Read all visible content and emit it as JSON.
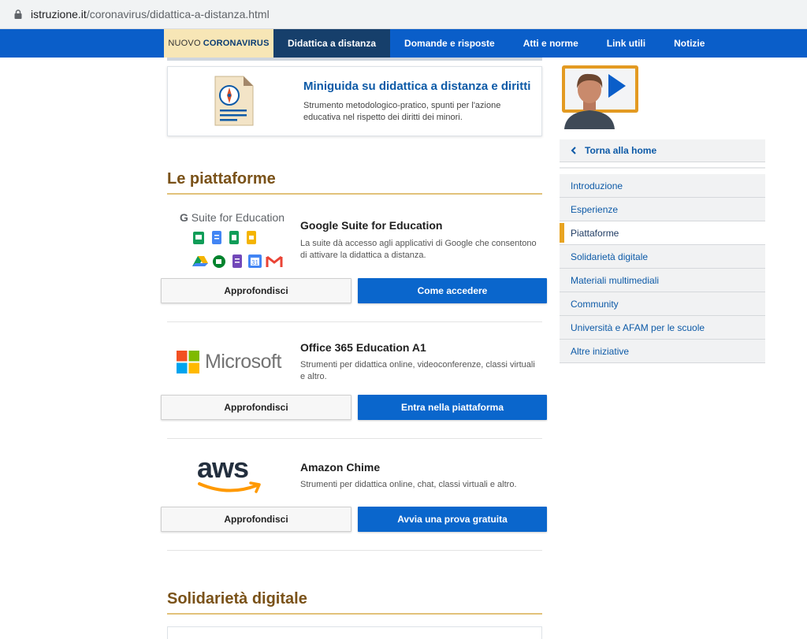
{
  "browser": {
    "url_domain": "istruzione.it",
    "url_path": "/coronavirus/didattica-a-distanza.html"
  },
  "nav": {
    "badge_prefix": "NUOVO",
    "badge_strong": "CORONAVIRUS",
    "items": [
      {
        "label": "Didattica a distanza",
        "active": true
      },
      {
        "label": "Domande e risposte"
      },
      {
        "label": "Atti e norme"
      },
      {
        "label": "Link utili"
      },
      {
        "label": "Notizie"
      }
    ]
  },
  "miniguide": {
    "title": "Miniguida su didattica a distanza e diritti",
    "description": "Strumento metodologico-pratico, spunti per l'azione educativa nel rispetto dei diritti dei minori."
  },
  "sections": {
    "platforms_title": "Le piattaforme",
    "solidarity_title": "Solidarietà digitale"
  },
  "platforms": [
    {
      "logo_text": "G Suite for Education",
      "logo_g": "G",
      "logo_rest": " Suite for Education",
      "title": "Google Suite for Education",
      "description": "La suite dà accesso agli applicativi di Google che consentono di attivare la didattica a distanza.",
      "btn_more": "Approfondisci",
      "btn_action": "Come accedere"
    },
    {
      "logo_text": "Microsoft",
      "title": "Office 365 Education A1",
      "description": "Strumenti per didattica online, videoconferenze, classi virtuali e altro.",
      "btn_more": "Approfondisci",
      "btn_action": "Entra nella piattaforma"
    },
    {
      "logo_text": "aws",
      "title": "Amazon Chime",
      "description": "Strumenti per didattica online, chat, classi virtuali e altro.",
      "btn_more": "Approfondisci",
      "btn_action": "Avvia una prova gratuita"
    }
  ],
  "sidebar": {
    "back_label": "Torna alla home",
    "items": [
      {
        "label": "Introduzione"
      },
      {
        "label": "Esperienze"
      },
      {
        "label": "Piattaforme",
        "active": true
      },
      {
        "label": "Solidarietà digitale"
      },
      {
        "label": "Materiali multimediali"
      },
      {
        "label": "Community"
      },
      {
        "label": "Università e AFAM per le scuole"
      },
      {
        "label": "Altre iniziative"
      }
    ]
  },
  "colors": {
    "nav_blue": "#0a5ec9",
    "nav_active": "#163f6b",
    "badge_bg": "#f7e6b6",
    "button_blue": "#0a66cc",
    "section_title": "#7a5219",
    "accent_orange": "#e8a422",
    "link_blue": "#0d5aa7"
  },
  "icons": {
    "lock": "lock-icon",
    "back": "chevron-left-icon",
    "miniguide": "document-compass-icon",
    "hero": "person-video-icon"
  }
}
